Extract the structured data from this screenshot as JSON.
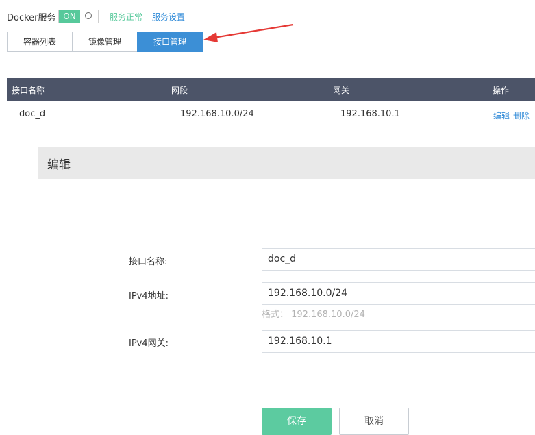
{
  "service": {
    "label": "Docker服务",
    "toggle_state": "ON",
    "status": "服务正常",
    "settings_link": "服务设置"
  },
  "tabs": [
    {
      "label": "容器列表",
      "active": false
    },
    {
      "label": "镜像管理",
      "active": false
    },
    {
      "label": "接口管理",
      "active": true
    }
  ],
  "table": {
    "columns": [
      "接口名称",
      "网段",
      "网关",
      "操作"
    ],
    "rows": [
      {
        "name": "doc_d",
        "subnet": "192.168.10.0/24",
        "gateway": "192.168.10.1",
        "actions": [
          "编辑",
          "删除"
        ]
      }
    ]
  },
  "edit_panel": {
    "title": "编辑",
    "fields": [
      {
        "label": "接口名称:",
        "value": "doc_d"
      },
      {
        "label": "IPv4地址:",
        "value": "192.168.10.0/24",
        "hint": "格式： 192.168.10.0/24"
      },
      {
        "label": "IPv4网关:",
        "value": "192.168.10.1"
      }
    ],
    "save_label": "保存",
    "cancel_label": "取消"
  },
  "colors": {
    "accent_green": "#57c99b",
    "accent_blue": "#3c8fd6",
    "table_header": "#4c5468",
    "annotation_arrow": "#e53935"
  }
}
